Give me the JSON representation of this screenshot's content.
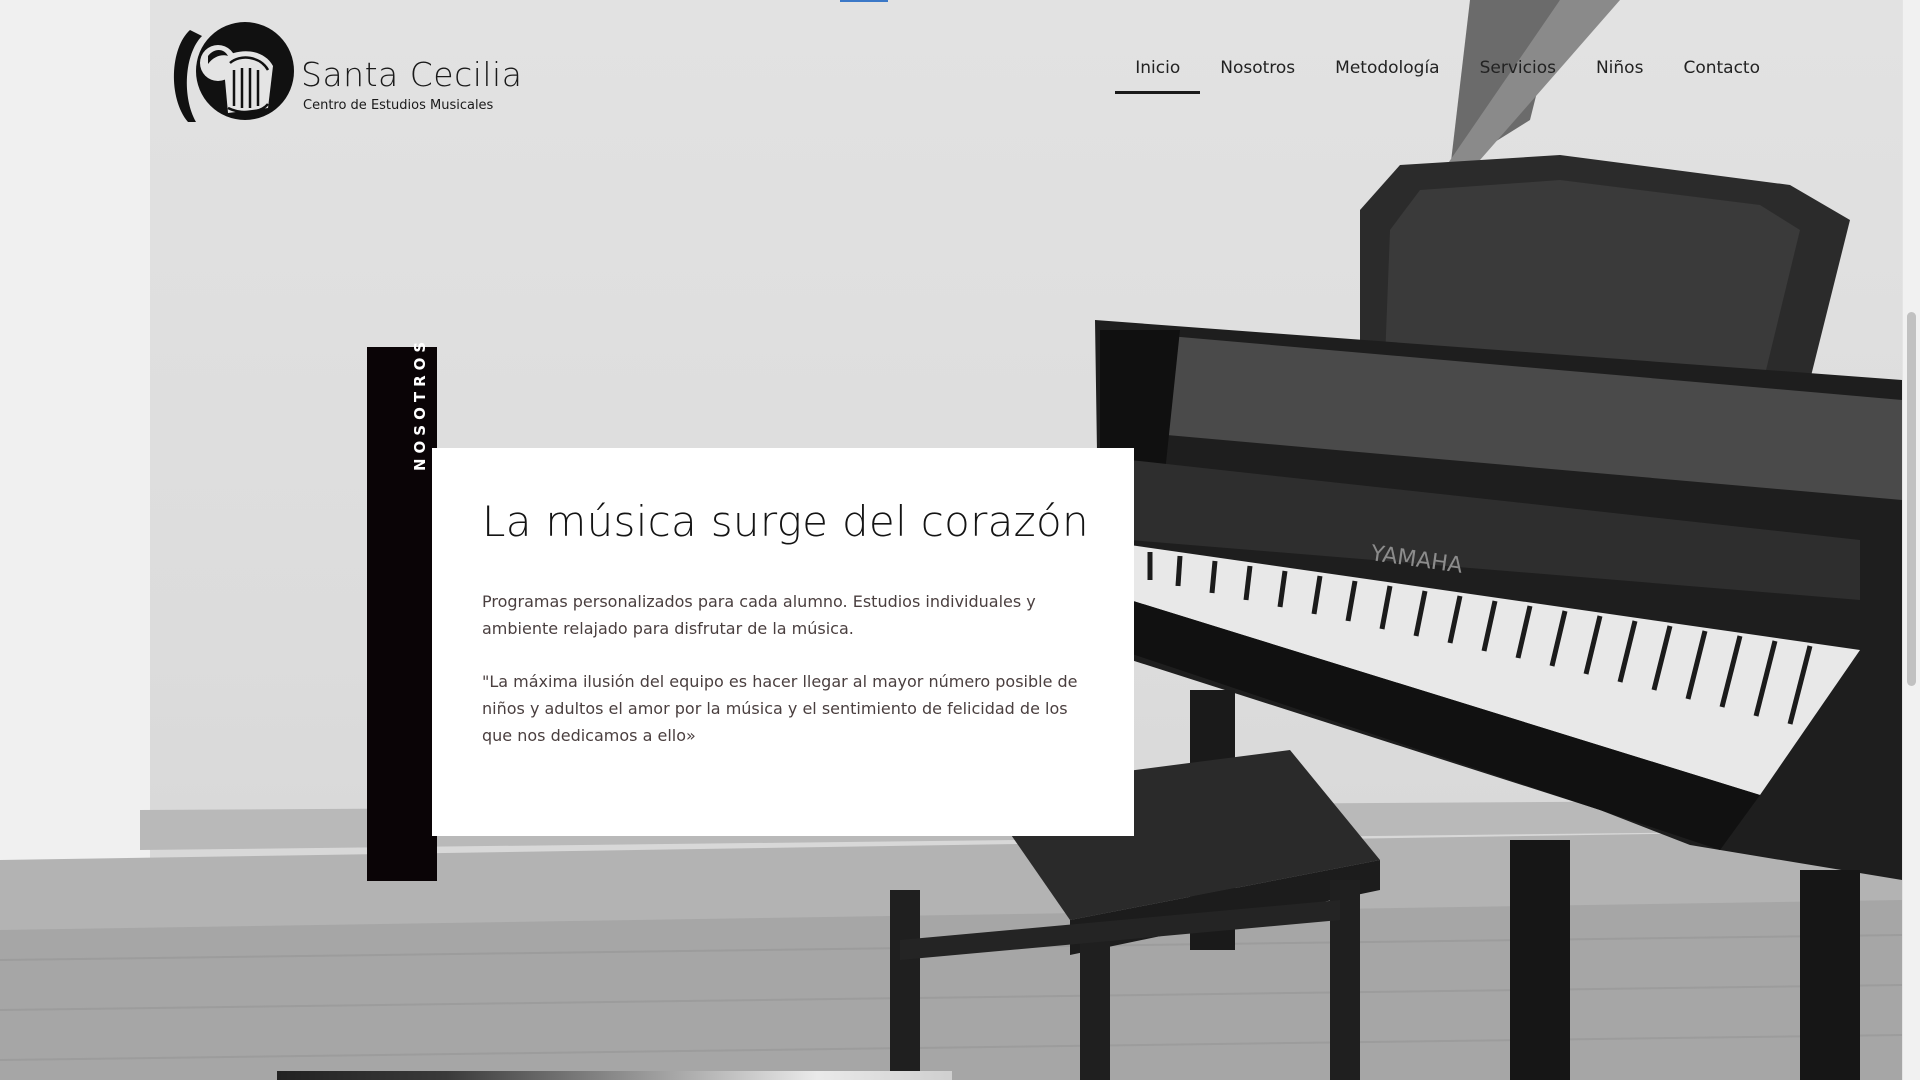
{
  "brand": {
    "name": "Santa Cecilia",
    "subtitle": "Centro de Estudios Musicales"
  },
  "nav": {
    "items": [
      {
        "label": "Inicio",
        "active": true
      },
      {
        "label": "Nosotros",
        "active": false
      },
      {
        "label": "Metodología",
        "active": false
      },
      {
        "label": "Servicios",
        "active": false
      },
      {
        "label": "Niños",
        "active": false
      },
      {
        "label": "Contacto",
        "active": false
      }
    ]
  },
  "section": {
    "tab_label": "NOSOTROS",
    "title": "La música surge del corazón",
    "paragraph_1": "Programas personalizados para cada alumno. Estudios individuales y ambiente relajado para disfrutar de la música.",
    "paragraph_2": "\"La máxima ilusión del equipo es hacer llegar al mayor número posible de niños y adultos el amor por la música y el sentimiento de felicidad de los que nos dedicamos a ello»"
  },
  "background": {
    "piano_brand": "YAMAHA"
  },
  "colors": {
    "tab_background": "#0a0406",
    "card_background": "#ffffff",
    "text_dark": "#141414",
    "text_body": "#4a3f3f",
    "accent_marker": "#3b78c7"
  }
}
